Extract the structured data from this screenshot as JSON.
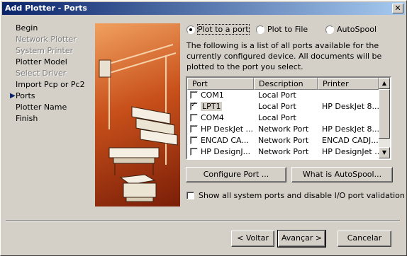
{
  "window": {
    "title": "Add Plotter - Ports",
    "close_label": "✕"
  },
  "steps": [
    {
      "label": "Begin",
      "disabled": false
    },
    {
      "label": "Network Plotter",
      "disabled": true
    },
    {
      "label": "System Printer",
      "disabled": true
    },
    {
      "label": "Plotter Model",
      "disabled": false
    },
    {
      "label": "Select Driver",
      "disabled": true
    },
    {
      "label": "Import Pcp or Pc2",
      "disabled": false
    },
    {
      "label": "Ports",
      "disabled": false,
      "current": true
    },
    {
      "label": "Plotter Name",
      "disabled": false
    },
    {
      "label": "Finish",
      "disabled": false
    }
  ],
  "current_marker": "▶",
  "options": {
    "plot_to_port": "Plot to a port",
    "plot_to_file": "Plot to File",
    "autospool": "AutoSpool",
    "selected": "plot_to_port"
  },
  "description": "The following is a list of all ports available for the currently configured device. All documents will be plotted to the port you select.",
  "ports_table": {
    "columns": [
      "Port",
      "Description",
      "Printer"
    ],
    "rows": [
      {
        "port": "COM1",
        "description": "Local Port",
        "printer": "",
        "checked": false
      },
      {
        "port": "LPT1",
        "description": "Local Port",
        "printer": "HP DeskJet 8...",
        "checked": true
      },
      {
        "port": "COM4",
        "description": "Local Port",
        "printer": "",
        "checked": false
      },
      {
        "port": "HP DeskJet ...",
        "description": "Network Port",
        "printer": "HP DeskJet 8...",
        "checked": false
      },
      {
        "port": "ENCAD CA...",
        "description": "Network Port",
        "printer": "ENCAD CADJ...",
        "checked": false
      },
      {
        "port": "HP DesignJ...",
        "description": "Network Port",
        "printer": "HP DesignJet ...",
        "checked": false
      }
    ]
  },
  "buttons": {
    "configure_port": "Configure Port ...",
    "what_is_autospool": "What is AutoSpool...",
    "back": "< Voltar",
    "next": "Avançar >",
    "cancel": "Cancelar"
  },
  "show_all_ports": {
    "label": "Show all system ports and disable I/O port validation",
    "checked": false
  },
  "colors": {
    "titlebar_start": "#0a246a",
    "titlebar_end": "#a6caf0",
    "dialog_bg": "#d4d0c8",
    "art_orange": "#c8501a"
  }
}
